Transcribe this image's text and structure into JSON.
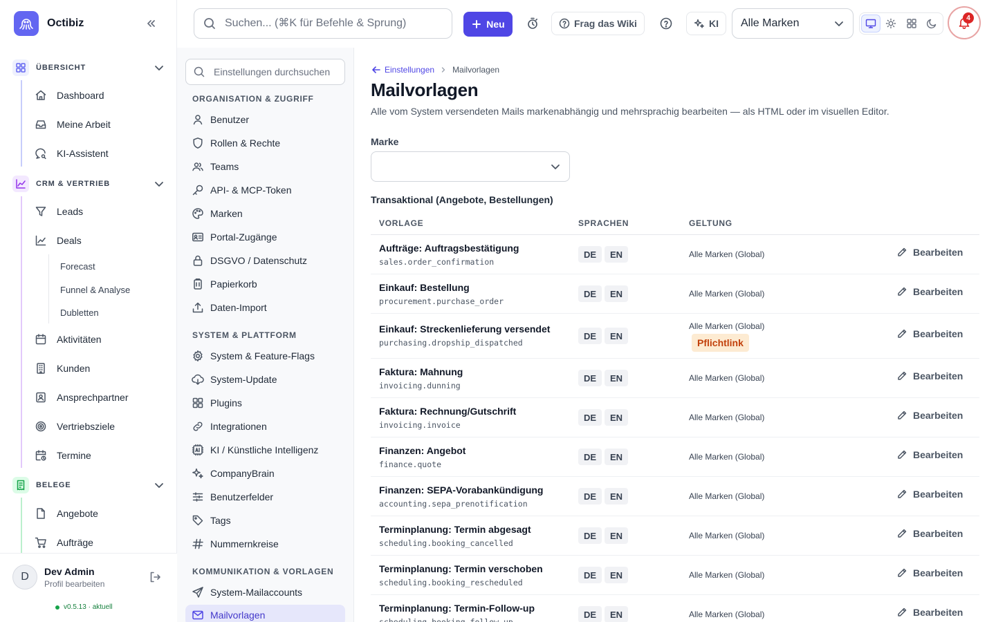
{
  "app": {
    "name": "Octibiz"
  },
  "sidebar": {
    "groups": [
      {
        "title": "ÜBERSICHT",
        "color": "#6366f1",
        "bg": "#eef0fe",
        "items": [
          "Dashboard",
          "Meine Arbeit",
          "KI-Assistent"
        ]
      },
      {
        "title": "CRM & VERTRIEB",
        "color": "#9333ea",
        "bg": "#f3e8ff",
        "items": [
          "Leads",
          "Deals",
          "Aktivitäten",
          "Kunden",
          "Ansprechpartner",
          "Vertriebsziele",
          "Termine"
        ],
        "subitems": [
          "Forecast",
          "Funnel & Analyse",
          "Dubletten"
        ]
      },
      {
        "title": "BELEGE",
        "color": "#16a34a",
        "bg": "#dcfce7",
        "items": [
          "Angebote",
          "Aufträge"
        ]
      }
    ],
    "user": {
      "initial": "D",
      "name": "Dev Admin",
      "sub": "Profil bearbeiten"
    },
    "version": "v0.5.13 · aktuell"
  },
  "topbar": {
    "search_placeholder": "Suchen... (⌘K für Befehle & Sprung)",
    "new_label": "Neu",
    "wiki_label": "Frag das Wiki",
    "ai_label": "KI",
    "brand_select": "Alle Marken",
    "notifications": "4",
    "accent": "#4f46e5"
  },
  "settings_nav": {
    "search_placeholder": "Einstellungen durchsuchen",
    "sections": [
      {
        "title": "ORGANISATION & ZUGRIFF",
        "items": [
          "Benutzer",
          "Rollen & Rechte",
          "Teams",
          "API- & MCP-Token",
          "Marken",
          "Portal-Zugänge",
          "DSGVO / Datenschutz",
          "Papierkorb",
          "Daten-Import"
        ]
      },
      {
        "title": "SYSTEM & PLATTFORM",
        "items": [
          "System & Feature-Flags",
          "System-Update",
          "Plugins",
          "Integrationen",
          "KI / Künstliche Intelligenz",
          "CompanyBrain",
          "Benutzerfelder",
          "Tags",
          "Nummernkreise"
        ]
      },
      {
        "title": "KOMMUNIKATION & VORLAGEN",
        "items": [
          "System-Mailaccounts",
          "Mailvorlagen"
        ]
      }
    ],
    "active": "Mailvorlagen"
  },
  "main": {
    "breadcrumb_back": "Einstellungen",
    "breadcrumb_current": "Mailvorlagen",
    "title": "Mailvorlagen",
    "description": "Alle vom System versendeten Mails markenabhängig und mehrsprachig bearbeiten — als HTML oder im visuellen Editor.",
    "brand_label": "Marke",
    "brand_value": "",
    "section_title": "Transaktional (Angebote, Bestellungen)",
    "columns": [
      "VORLAGE",
      "SPRACHEN",
      "GELTUNG"
    ],
    "edit_label": "Bearbeiten",
    "rows": [
      {
        "name": "Aufträge: Auftragsbestätigung",
        "key": "sales.order_confirmation",
        "langs": [
          "DE",
          "EN"
        ],
        "scope": "Alle Marken (Global)"
      },
      {
        "name": "Einkauf: Bestellung",
        "key": "procurement.purchase_order",
        "langs": [
          "DE",
          "EN"
        ],
        "scope": "Alle Marken (Global)"
      },
      {
        "name": "Einkauf: Streckenlieferung versendet",
        "key": "purchasing.dropship_dispatched",
        "langs": [
          "DE",
          "EN"
        ],
        "scope": "Alle Marken (Global)",
        "badge": "Pflichtlink"
      },
      {
        "name": "Faktura: Mahnung",
        "key": "invoicing.dunning",
        "langs": [
          "DE",
          "EN"
        ],
        "scope": "Alle Marken (Global)"
      },
      {
        "name": "Faktura: Rechnung/Gutschrift",
        "key": "invoicing.invoice",
        "langs": [
          "DE",
          "EN"
        ],
        "scope": "Alle Marken (Global)"
      },
      {
        "name": "Finanzen: Angebot",
        "key": "finance.quote",
        "langs": [
          "DE",
          "EN"
        ],
        "scope": "Alle Marken (Global)"
      },
      {
        "name": "Finanzen: SEPA-Vorabankündigung",
        "key": "accounting.sepa_prenotification",
        "langs": [
          "DE",
          "EN"
        ],
        "scope": "Alle Marken (Global)"
      },
      {
        "name": "Terminplanung: Termin abgesagt",
        "key": "scheduling.booking_cancelled",
        "langs": [
          "DE",
          "EN"
        ],
        "scope": "Alle Marken (Global)"
      },
      {
        "name": "Terminplanung: Termin verschoben",
        "key": "scheduling.booking_rescheduled",
        "langs": [
          "DE",
          "EN"
        ],
        "scope": "Alle Marken (Global)"
      },
      {
        "name": "Terminplanung: Termin-Follow-up",
        "key": "scheduling.booking_follow_up",
        "langs": [
          "DE",
          "EN"
        ],
        "scope": "Alle Marken (Global)"
      }
    ]
  }
}
